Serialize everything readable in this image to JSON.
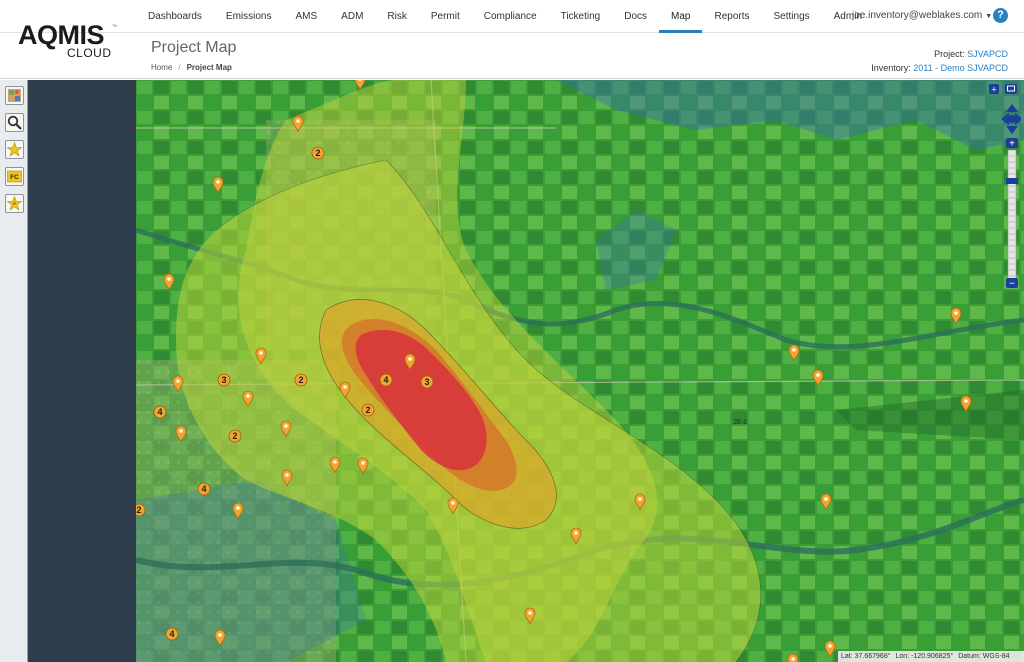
{
  "brand": {
    "name_line1": "AQMIS",
    "name_line2": "CLOUD",
    "tm": "™"
  },
  "nav": [
    {
      "label": "Dashboards",
      "active": false
    },
    {
      "label": "Emissions",
      "active": false
    },
    {
      "label": "AMS",
      "active": false
    },
    {
      "label": "ADM",
      "active": false
    },
    {
      "label": "Risk",
      "active": false
    },
    {
      "label": "Permit",
      "active": false
    },
    {
      "label": "Compliance",
      "active": false
    },
    {
      "label": "Ticketing",
      "active": false
    },
    {
      "label": "Docs",
      "active": false
    },
    {
      "label": "Map",
      "active": true
    },
    {
      "label": "Reports",
      "active": false
    },
    {
      "label": "Settings",
      "active": false
    },
    {
      "label": "Admin",
      "active": false
    }
  ],
  "user": {
    "email": "joe.inventory@weblakes.com",
    "help": "?"
  },
  "header": {
    "title": "Project Map",
    "breadcrumb": {
      "home": "Home",
      "sep": "/",
      "current": "Project Map"
    },
    "project_label": "Project:",
    "project_value": "SJVAPCD",
    "inventory_label": "Inventory:",
    "inventory_value": "2011 - Demo SJVAPCD"
  },
  "toolbar": [
    {
      "icon": "layers-icon"
    },
    {
      "icon": "zoom-magnifier-icon"
    },
    {
      "icon": "source-icon"
    },
    {
      "icon": "facility-icon",
      "text": "FC"
    },
    {
      "icon": "receptor-icon"
    }
  ],
  "map": {
    "colors": {
      "high": "#d8323c",
      "mid": "#e0a328",
      "low": "#b9d43a",
      "base": "#3cae3a",
      "water": "#3a6fb0",
      "marker": "#f2a531"
    },
    "markers": [
      {
        "type": "pin"
      },
      {
        "type": "pin"
      },
      {
        "type": "pin"
      },
      {
        "type": "pin"
      },
      {
        "type": "pin"
      },
      {
        "type": "pin"
      },
      {
        "type": "pin"
      },
      {
        "type": "pin"
      },
      {
        "type": "pin"
      },
      {
        "type": "pin"
      },
      {
        "type": "pin"
      },
      {
        "type": "pin"
      },
      {
        "type": "pin"
      },
      {
        "type": "pin"
      },
      {
        "type": "pin"
      },
      {
        "type": "pin"
      },
      {
        "type": "pin"
      },
      {
        "type": "pin"
      },
      {
        "type": "pin"
      },
      {
        "type": "pin"
      },
      {
        "type": "pin"
      },
      {
        "type": "pin"
      },
      {
        "type": "pin"
      },
      {
        "type": "pin"
      },
      {
        "type": "pin"
      },
      {
        "type": "pin"
      },
      {
        "type": "pin"
      }
    ],
    "clusters": [
      {
        "count": "2"
      },
      {
        "count": "3"
      },
      {
        "count": "2"
      },
      {
        "count": "4"
      },
      {
        "count": "3"
      },
      {
        "count": "4"
      },
      {
        "count": "2"
      },
      {
        "count": "2"
      },
      {
        "count": "4"
      },
      {
        "count": "2"
      },
      {
        "count": "4"
      }
    ],
    "road_labels": [
      "2E-2"
    ]
  },
  "status": {
    "lat": "Lat: 37.667968°",
    "lon": "Lon: -120.906825°",
    "datum": "Datum: WGS-84"
  }
}
